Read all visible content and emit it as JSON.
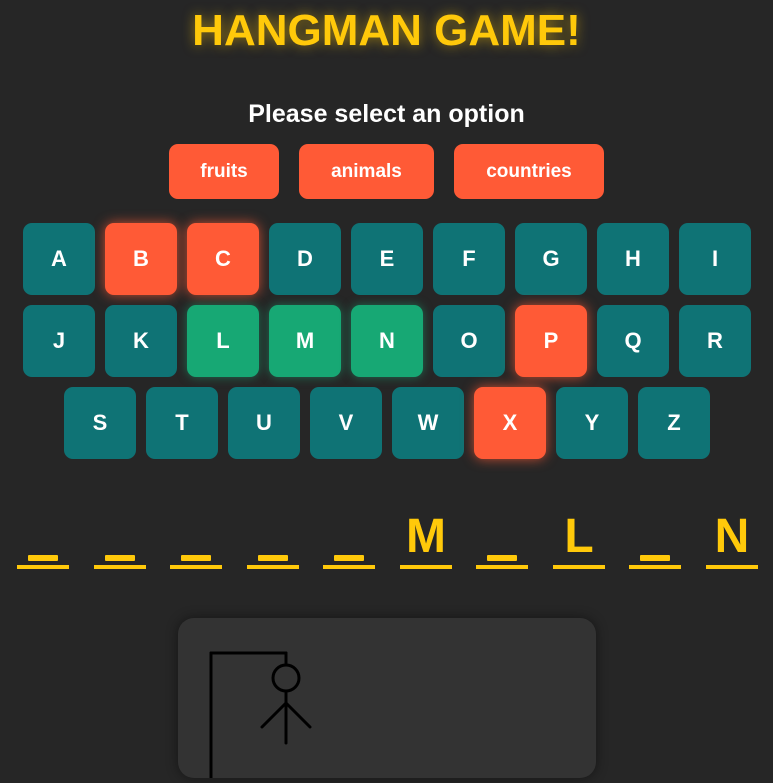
{
  "title": "HANGMAN GAME!",
  "prompt": "Please select an option",
  "options": [
    "fruits",
    "animals",
    "countries"
  ],
  "keyboard": {
    "rows": [
      [
        "A",
        "B",
        "C",
        "D",
        "E",
        "F",
        "G",
        "H",
        "I"
      ],
      [
        "J",
        "K",
        "L",
        "M",
        "N",
        "O",
        "P",
        "Q",
        "R"
      ],
      [
        "S",
        "T",
        "U",
        "V",
        "W",
        "X",
        "Y",
        "Z"
      ]
    ],
    "wrong": [
      "B",
      "C",
      "P",
      "X"
    ],
    "correct": [
      "L",
      "M",
      "N"
    ]
  },
  "word_slots": [
    "_",
    "_",
    "_",
    "_",
    "_",
    "M",
    "_",
    "L",
    "_",
    "N"
  ],
  "colors": {
    "background": "#262626",
    "accent_yellow": "#ffc90a",
    "key_default": "#0f7375",
    "key_wrong": "#ff5a36",
    "key_correct": "#17a874",
    "option_button": "#ff5a36"
  }
}
